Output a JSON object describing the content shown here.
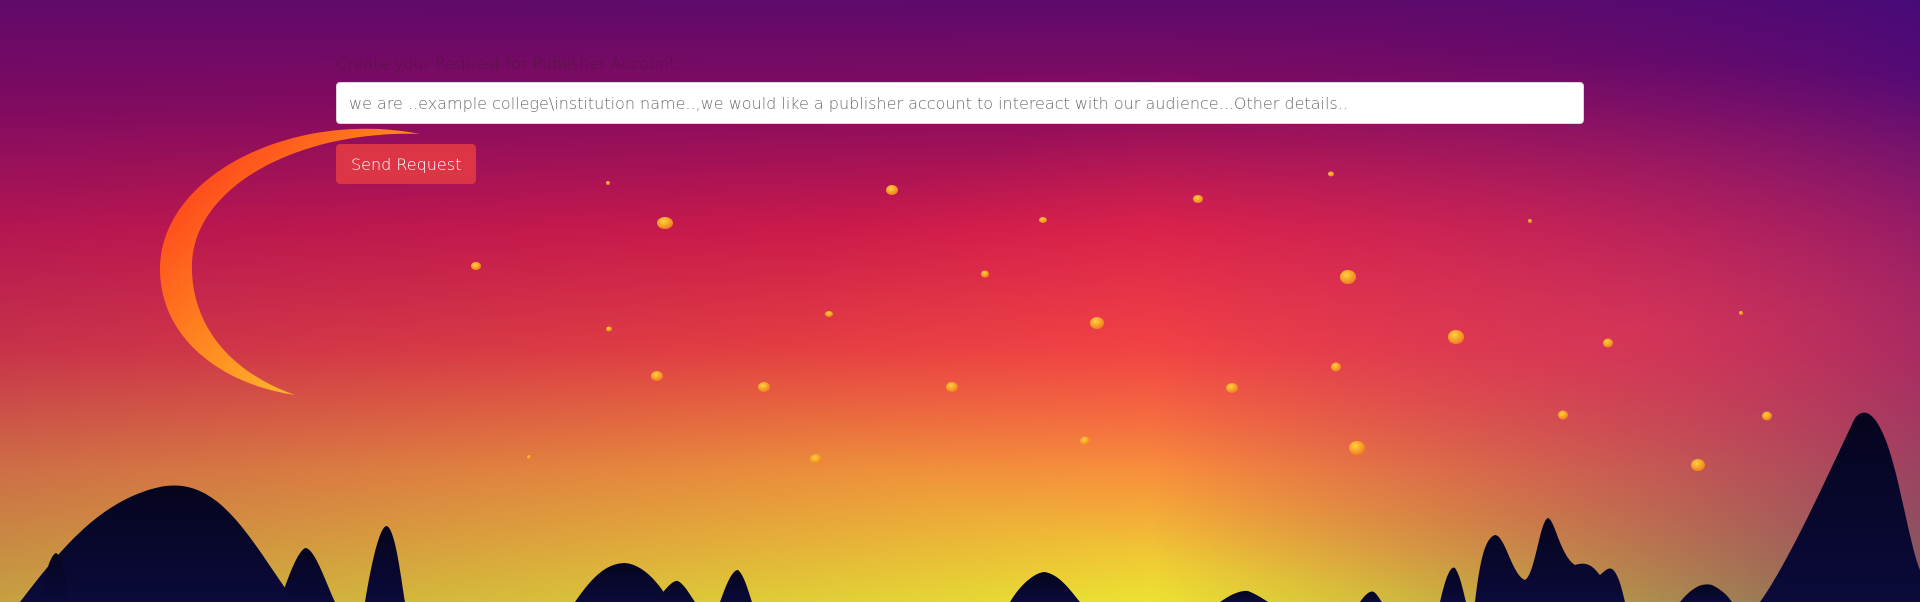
{
  "form": {
    "label": "Create your Request for Publisher Account",
    "input_placeholder": "we are ..example college\\institution name..,we would like a publisher account to intereact with our audience...Other details..",
    "input_value": "",
    "send_label": "Send Request"
  },
  "background": {
    "sky_top": "#5a0a6a",
    "sky_mid": "#e8334a",
    "sky_low": "#f06a3a",
    "horizon": "#e8d030",
    "moon_outer": "#ff3d20",
    "moon_inner": "#ffd83a",
    "star_color": "#ffb020",
    "mountain_color": "#06062a"
  }
}
